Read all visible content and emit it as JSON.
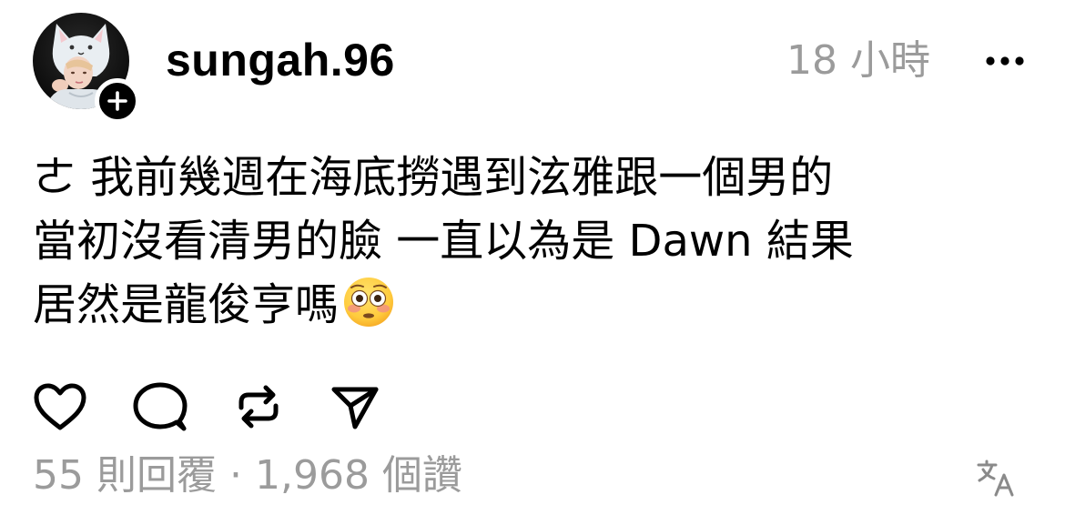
{
  "post": {
    "username": "sungah.96",
    "timestamp": "18 小時",
    "text_lines": [
      "ㄜ 我前幾週在海底撈遇到泫雅跟一個男的",
      "當初沒看清男的臉 一直以為是 Dawn 結果",
      "居然是龍俊亨嗎"
    ],
    "emoji": "flushed-face-emoji",
    "replies": "55 則回覆",
    "separator": "·",
    "likes": "1,968 個讚"
  },
  "icons": {
    "avatar": "profile-photo",
    "follow": "plus-icon",
    "more": "more-icon",
    "like": "heart-icon",
    "reply": "comment-icon",
    "repost": "repost-icon",
    "share": "send-icon",
    "translate": "translate-icon"
  },
  "colors": {
    "text": "#000000",
    "muted": "#9b9b9b",
    "background": "#ffffff"
  }
}
